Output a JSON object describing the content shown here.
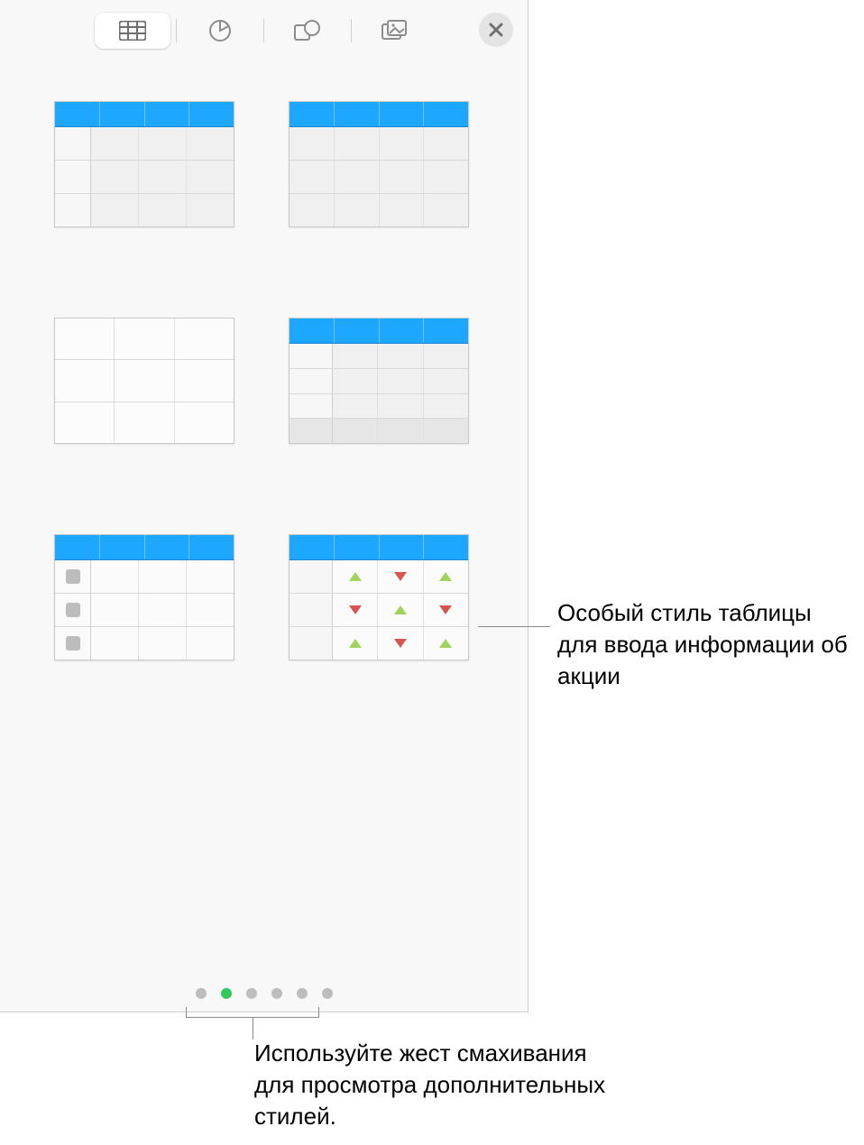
{
  "toolbar": {
    "tabs": [
      {
        "id": "table",
        "selected": true
      },
      {
        "id": "chart",
        "selected": false
      },
      {
        "id": "shape",
        "selected": false
      },
      {
        "id": "media",
        "selected": false
      }
    ],
    "close_label": "✕"
  },
  "pager": {
    "total": 6,
    "active_index": 1
  },
  "callouts": {
    "stock_style": "Особый стиль таблицы для ввода информации об акции",
    "swipe_hint": "Используйте жест смахивания для просмотра дополнительных стилей."
  },
  "colors": {
    "header": "#1ea7ff",
    "accent_green": "#34c759"
  }
}
